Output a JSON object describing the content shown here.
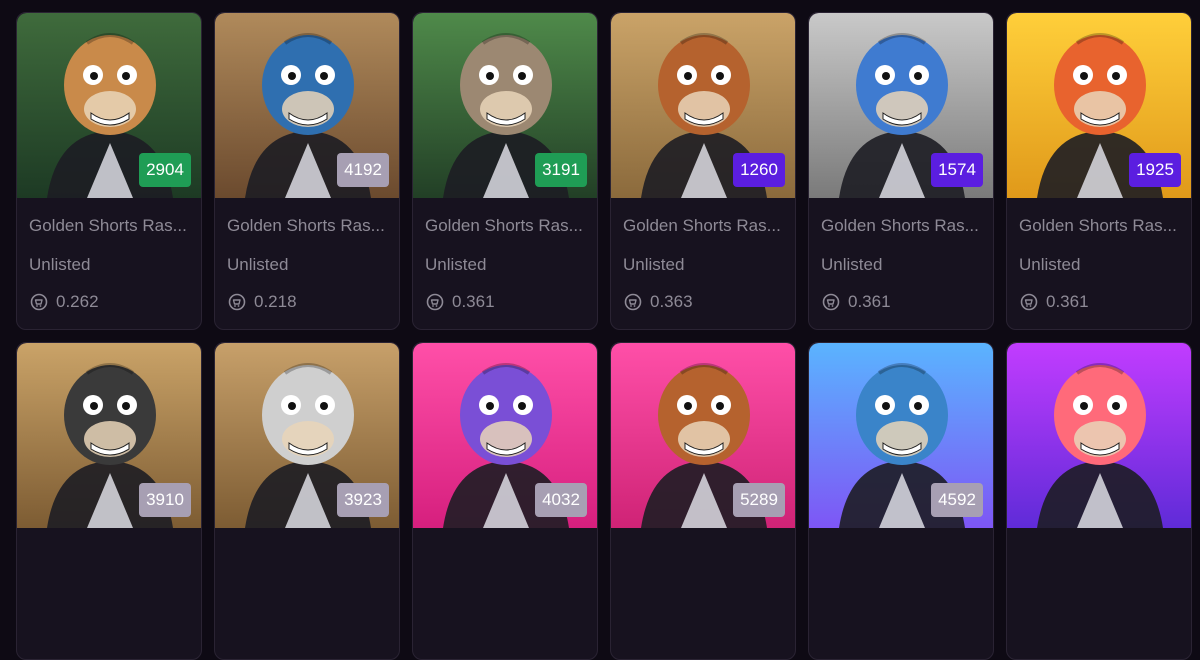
{
  "colors": {
    "badge_green": "#1f9d55",
    "badge_grey": "#a79fb3",
    "badge_purple": "#5b1ee0",
    "card_bg": "#17121f",
    "page_bg": "#0e0a14",
    "text_muted": "#8e8a96"
  },
  "icons": {
    "price": "refresh-cart-icon"
  },
  "cards": [
    {
      "number": "2904",
      "badge": "green",
      "title": "Golden Shorts Ras...",
      "status": "Unlisted",
      "price": "0.262",
      "art": "crocodile-nft-image",
      "bg1": "#3f6b3c",
      "bg2": "#1d3a24",
      "fg": "#c98a4a"
    },
    {
      "number": "4192",
      "badge": "grey",
      "title": "Golden Shorts Ras...",
      "status": "Unlisted",
      "price": "0.218",
      "art": "blue-lion-nft-image",
      "bg1": "#b08a5b",
      "bg2": "#6b4a2e",
      "fg": "#2f6fb0"
    },
    {
      "number": "3191",
      "badge": "green",
      "title": "Golden Shorts Ras...",
      "status": "Unlisted",
      "price": "0.361",
      "art": "bear-cap-nft-image",
      "bg1": "#4f8a4a",
      "bg2": "#223f26",
      "fg": "#9c8872"
    },
    {
      "number": "1260",
      "badge": "purple",
      "title": "Golden Shorts Ras...",
      "status": "Unlisted",
      "price": "0.363",
      "art": "lion-visor-nft-image",
      "bg1": "#caa368",
      "bg2": "#8b6a3c",
      "fg": "#b5622e"
    },
    {
      "number": "1574",
      "badge": "purple",
      "title": "Golden Shorts Ras...",
      "status": "Unlisted",
      "price": "0.361",
      "art": "blue-bear-wanted-nft-image",
      "bg1": "#c9c9c9",
      "bg2": "#7a7a7a",
      "fg": "#3f7bd0"
    },
    {
      "number": "1925",
      "badge": "purple",
      "title": "Golden Shorts Ras...",
      "status": "Unlisted",
      "price": "0.361",
      "art": "rainbow-lion-nft-image",
      "bg1": "#ffcf3a",
      "bg2": "#e0991a",
      "fg": "#e8632e"
    },
    {
      "number": "3910",
      "badge": "grey",
      "art": "wolf-orange-nft-image",
      "bg1": "#caa368",
      "bg2": "#7d5c33",
      "fg": "#3a3a3a"
    },
    {
      "number": "3923",
      "badge": "grey",
      "art": "grey-lion-nft-image",
      "bg1": "#c7a06a",
      "bg2": "#7d5c33",
      "fg": "#cfcfcf"
    },
    {
      "number": "4032",
      "badge": "grey",
      "art": "galaxy-bear-nft-image",
      "bg1": "#ff4fa8",
      "bg2": "#d61f7e",
      "fg": "#7a4fd6"
    },
    {
      "number": "5289",
      "badge": "grey",
      "art": "lion-bat-nft-image",
      "bg1": "#ff4fa8",
      "bg2": "#cf2376",
      "fg": "#b5622e"
    },
    {
      "number": "4592",
      "badge": "grey",
      "art": "blue-bear-shirt-nft-image",
      "bg1": "#5ab4ff",
      "bg2": "#7e56f5",
      "fg": "#3a84c9"
    },
    {
      "number": "",
      "badge": "none",
      "art": "pink-wolf-nft-image",
      "bg1": "#c23cff",
      "bg2": "#5f2bd8",
      "fg": "#ff6a7a"
    }
  ]
}
